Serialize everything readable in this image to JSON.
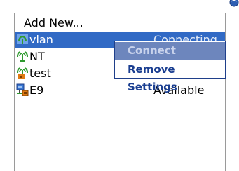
{
  "networks": {
    "add_label": "Add New...",
    "items": [
      {
        "name": "vlan",
        "status": "Connecting",
        "icon": "wifi-signal-icon",
        "selected": true
      },
      {
        "name": "NT",
        "status": "",
        "icon": "wifi-signal-icon",
        "selected": false
      },
      {
        "name": "test",
        "status": "",
        "icon": "wifi-signal-locked-icon",
        "selected": false
      },
      {
        "name": "E9",
        "status": "Available",
        "icon": "wired-network-icon",
        "selected": false
      }
    ]
  },
  "context_menu": {
    "connect_label": "Connect",
    "remove_label": "Remove Settings"
  },
  "colors": {
    "selection": "#316ac5",
    "menu_active": "#6d86bd",
    "menu_text": "#1b3f91",
    "signal_green": "#2f9a2f",
    "lock_orange": "#e07a12"
  }
}
